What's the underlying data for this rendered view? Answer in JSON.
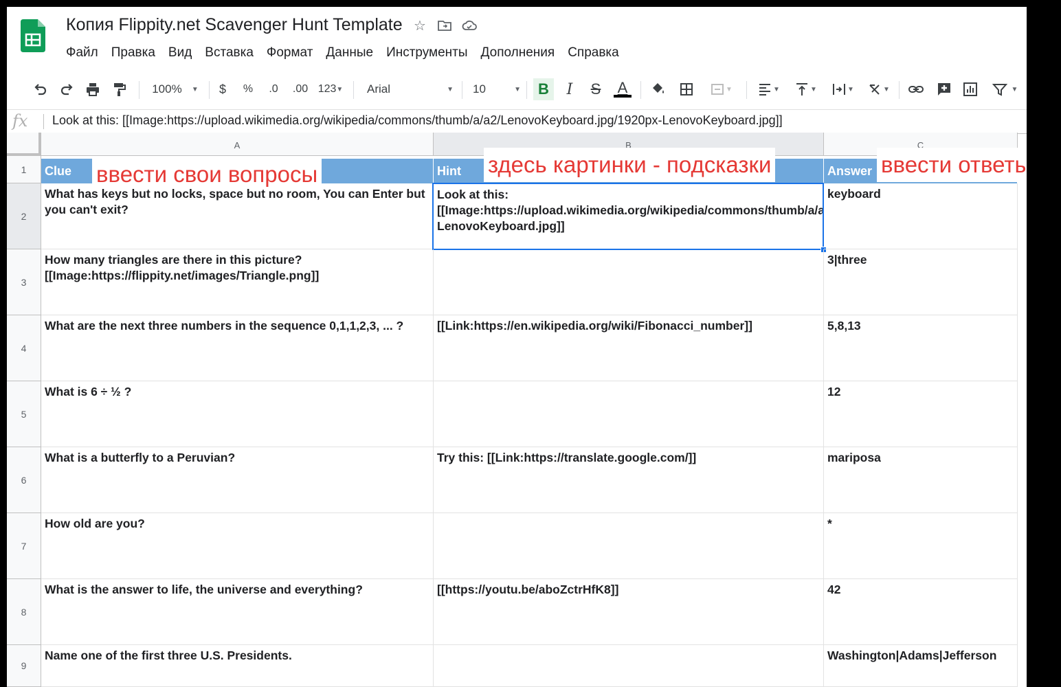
{
  "document": {
    "title": "Копия Flippity.net Scavenger Hunt Template"
  },
  "menu": [
    "Файл",
    "Правка",
    "Вид",
    "Вставка",
    "Формат",
    "Данные",
    "Инструменты",
    "Дополнения",
    "Справка"
  ],
  "toolbar": {
    "zoom": "100%",
    "currency": "$",
    "percent": "%",
    "dec_decrease": ".0",
    "dec_increase": ".00",
    "more_formats": "123",
    "font": "Arial",
    "font_size": "10",
    "bold": "B",
    "italic": "I",
    "strike": "S",
    "text_color": "A",
    "text_color_hex": "#000000"
  },
  "formula_bar": {
    "fx": "fx",
    "content": "Look at this: [[Image:https://upload.wikimedia.org/wikipedia/commons/thumb/a/a2/LenovoKeyboard.jpg/1920px-LenovoKeyboard.jpg]]"
  },
  "columns": [
    "A",
    "B",
    "C"
  ],
  "header_row": {
    "num": "1",
    "clue": "Clue",
    "hint": "Hint",
    "answer": "Answer"
  },
  "annotations": {
    "questions": "ввести свои вопросы",
    "hints": "здесь картинки - подсказки",
    "answers": "ввести ответы"
  },
  "rows": [
    {
      "num": "2",
      "clue": "What has keys but no locks, space but no room, You can Enter but you can't exit?",
      "hint": "Look at this: [[Image:https://upload.wikimedia.org/wikipedia/commons/thumb/a/a2/LenovoKeyboard.jpg/1920px-LenovoKeyboard.jpg]]",
      "answer": "keyboard"
    },
    {
      "num": "3",
      "clue": "How many triangles are there in this picture? [[Image:https://flippity.net/images/Triangle.png]]",
      "hint": "",
      "answer": "3|three"
    },
    {
      "num": "4",
      "clue": "What are the next three numbers in the sequence 0,1,1,2,3, ... ?",
      "hint": "[[Link:https://en.wikipedia.org/wiki/Fibonacci_number]]",
      "answer": "5,8,13"
    },
    {
      "num": "5",
      "clue": "What is 6 ÷ ½ ?",
      "hint": "",
      "answer": "12"
    },
    {
      "num": "6",
      "clue": "What is a butterfly to a Peruvian?",
      "hint": "Try this: [[Link:https://translate.google.com/]]",
      "answer": "mariposa"
    },
    {
      "num": "7",
      "clue": "How old are you?",
      "hint": "",
      "answer": "*"
    },
    {
      "num": "8",
      "clue": "What is the answer to life, the universe and everything?",
      "hint": "[[https://youtu.be/aboZctrHfK8]]",
      "answer": "42"
    },
    {
      "num": "9",
      "clue": "Name one of the first three U.S. Presidents.",
      "hint": "",
      "answer": "Washington|Adams|Jefferson"
    }
  ],
  "colors": {
    "header_fill": "#6fa8dc",
    "annotation": "#e53935",
    "selection": "#1a73e8",
    "sheets_green": "#0f9d58"
  }
}
